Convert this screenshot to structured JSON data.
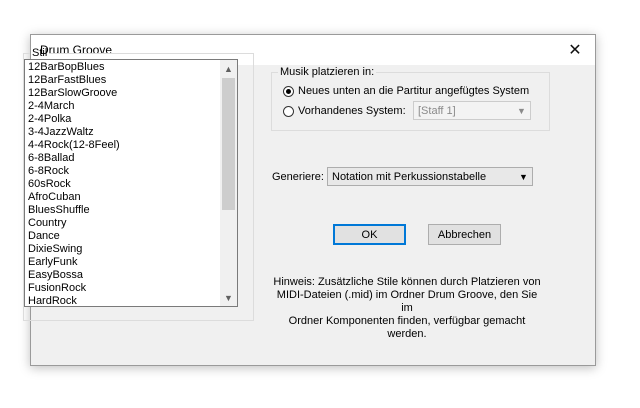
{
  "window": {
    "title": "Drum Groove",
    "close_icon": "close-icon"
  },
  "stil": {
    "label": "Stil",
    "items": [
      "12BarBopBlues",
      "12BarFastBlues",
      "12BarSlowGroove",
      "2-4March",
      "2-4Polka",
      "3-4JazzWaltz",
      "4-4Rock(12-8Feel)",
      "6-8Ballad",
      "6-8Rock",
      "60sRock",
      "AfroCuban",
      "BluesShuffle",
      "Country",
      "Dance",
      "DixieSwing",
      "EarlyFunk",
      "EasyBossa",
      "FusionRock",
      "HardRock"
    ]
  },
  "musik": {
    "label": "Musik platzieren in:",
    "option_new": "Neues unten an die Partitur angefügtes System",
    "option_existing": "Vorhandenes System:",
    "existing_value": "[Staff 1]",
    "selected": "new"
  },
  "generiere": {
    "label": "Generiere:",
    "value": "Notation mit Perkussionstabelle"
  },
  "buttons": {
    "ok": "OK",
    "cancel": "Abbrechen"
  },
  "hint": {
    "line1": "Hinweis: Zusätzliche Stile können durch Platzieren von",
    "line2": "MIDI-Dateien (.mid) im Ordner Drum Groove, den Sie im",
    "line3": "Ordner Komponenten finden, verfügbar gemacht werden."
  }
}
